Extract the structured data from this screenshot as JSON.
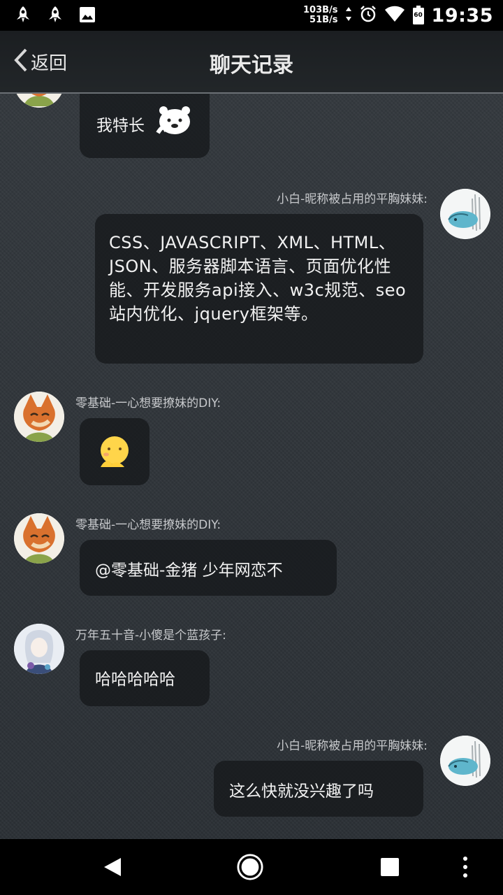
{
  "status_bar": {
    "speed_up": "103B/s",
    "speed_down": "51B/s",
    "battery_level": "60",
    "time": "19:35"
  },
  "header": {
    "back_label": "返回",
    "title": "聊天记录"
  },
  "messages": [
    {
      "sender": "",
      "text": "我特长",
      "side": "left",
      "emoji": "bear-sticker"
    },
    {
      "sender": "小白-昵称被占用的平胸妹妹:",
      "text": "CSS、JAVASCRIPT、XML、HTML、JSON、服务器脚本语言、页面优化性能、开发服务api接入、w3c规范、seo站内优化、jquery框架等。",
      "side": "right"
    },
    {
      "sender": "零基础-一心想要撩妹的DIY:",
      "text": "",
      "side": "left",
      "emoji": "thinking-emoji"
    },
    {
      "sender": "零基础-一心想要撩妹的DIY:",
      "text": "@零基础-金猪 少年网恋不",
      "side": "left"
    },
    {
      "sender": "万年五十音-小傻是个蓝孩子:",
      "text": "哈哈哈哈哈",
      "side": "left"
    },
    {
      "sender": "小白-昵称被占用的平胸妹妹:",
      "text": "这么快就没兴趣了吗",
      "side": "right"
    }
  ],
  "colors": {
    "background": "#2e3338",
    "bubble": "#16181b",
    "name_text": "#c7c9cc",
    "bar": "#000000"
  }
}
